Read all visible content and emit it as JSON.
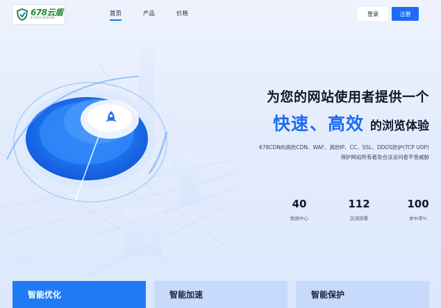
{
  "header": {
    "logo": {
      "main": "678云盾",
      "sub": "678YUNDUN"
    },
    "nav": [
      "首页",
      "产品",
      "价格"
    ],
    "login_label": "登录",
    "register_label": "注册"
  },
  "hero": {
    "title_line1": "为您的网站使用者提供一个",
    "highlight_1": "快速",
    "highlight_sep": "、",
    "highlight_2": "高效",
    "title_tail": "的浏览体验",
    "desc_line1": "678CDN的高防CDN、WAF、高防IP、CC、SSL、DDOS防护(TCP UDP)",
    "desc_line2": "保护网站所有者及合法访问者不受威胁"
  },
  "stats": [
    {
      "value": "40",
      "label": "数据中心"
    },
    {
      "value": "112",
      "label": "区域部署"
    },
    {
      "value": "100",
      "label": "命中率%"
    }
  ],
  "cards": [
    "智能优化",
    "智能加速",
    "智能保护"
  ],
  "colors": {
    "accent": "#1e6cf5",
    "card_active": "#1e7bf5",
    "card_inactive": "#c7dafc"
  }
}
